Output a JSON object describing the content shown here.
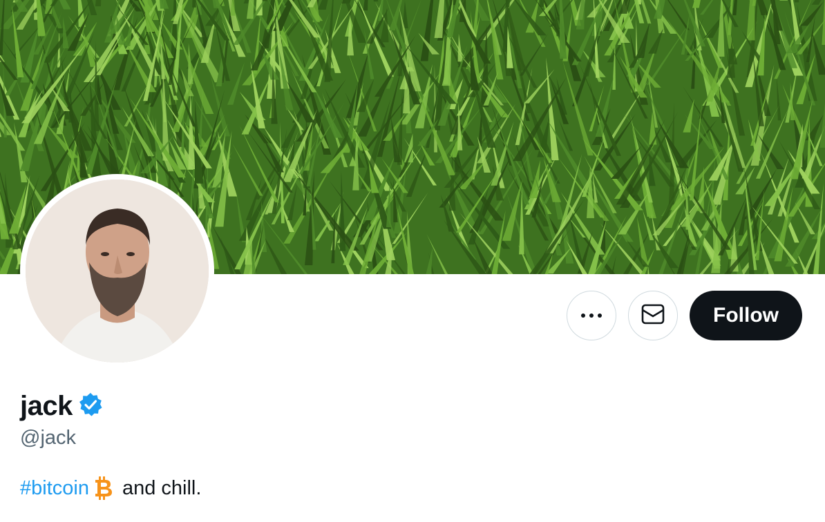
{
  "banner": {
    "image": "grass-field",
    "colors": {
      "dark": "#2f5a17",
      "mid": "#4f8a2a",
      "light": "#9fd25e"
    }
  },
  "avatar": {
    "image": "profile-photo"
  },
  "actions": {
    "more_icon": "ellipsis-icon",
    "message_icon": "envelope-icon",
    "follow_label": "Follow"
  },
  "profile": {
    "name": "jack",
    "verified_icon": "verified-badge-icon",
    "handle": "@jack",
    "bio": {
      "hashtag": "#bitcoin",
      "emoji_icon": "bitcoin-icon",
      "rest": "and chill."
    }
  },
  "colors": {
    "accent": "#1d9bf0",
    "text": "#0f1419",
    "muted": "#536471",
    "bitcoin": "#f7931a"
  }
}
